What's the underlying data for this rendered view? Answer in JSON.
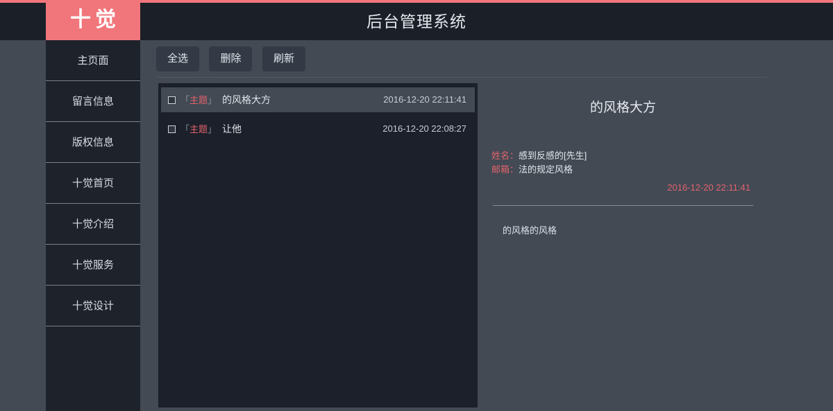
{
  "theme": {
    "accent": "#f1767b",
    "header_bg": "#1b2028",
    "sidebar_bg": "#1d222b",
    "page_bg": "#434a54",
    "panel_dark": "#1b202a",
    "text": "#e6e9ed",
    "label_red": "#e2636c"
  },
  "header": {
    "logo": "十觉",
    "title": "后台管理系统"
  },
  "sidebar": {
    "items": [
      {
        "label": "主页面",
        "active": true
      },
      {
        "label": "留言信息",
        "active": false
      },
      {
        "label": "版权信息",
        "active": false
      },
      {
        "label": "十觉首页",
        "active": false
      },
      {
        "label": "十觉介绍",
        "active": false
      },
      {
        "label": "十觉服务",
        "active": false
      },
      {
        "label": "十觉设计",
        "active": false
      }
    ]
  },
  "toolbar": {
    "select_all_label": "全选",
    "delete_label": "删除",
    "refresh_label": "刷新"
  },
  "message_list": {
    "rows": [
      {
        "tag_open": "「",
        "tag_text": "主题",
        "tag_close": "」",
        "title": "的风格大方",
        "time": "2016-12-20 22:11:41",
        "selected": true,
        "checked": false
      },
      {
        "tag_open": "「",
        "tag_text": "主题",
        "tag_close": "」",
        "title": "让他",
        "time": "2016-12-20 22:08:27",
        "selected": false,
        "checked": false
      }
    ]
  },
  "detail": {
    "title": "的风格大方",
    "name_label": "姓名：",
    "name_value": "感到反感的[先生]",
    "email_label": "邮箱：",
    "email_value": "法的规定风格",
    "time": "2016-12-20 22:11:41",
    "body": "的风格的风格"
  }
}
